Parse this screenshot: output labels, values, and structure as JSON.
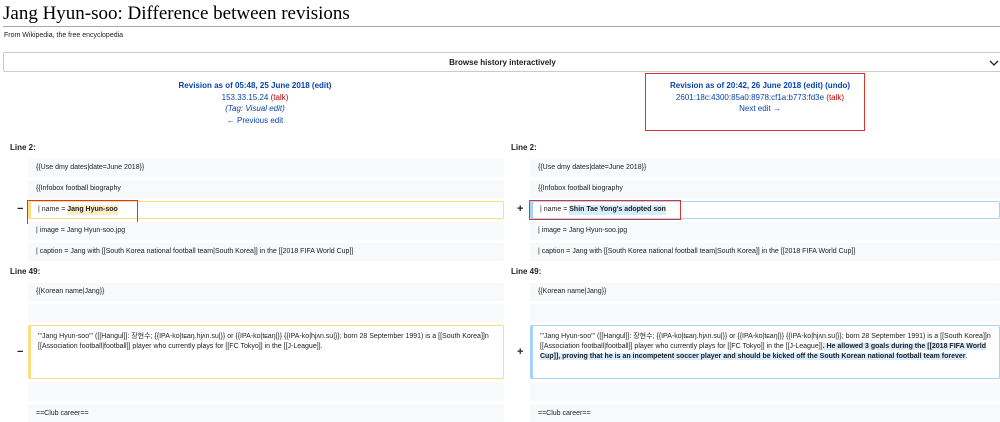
{
  "page": {
    "title": "Jang Hyun-soo: Difference between revisions",
    "subtitle": "From Wikipedia, the free encyclopedia"
  },
  "browse": {
    "label": "Browse history interactively",
    "icon": "chevron-down-icon"
  },
  "left_rev": {
    "title": "Revision as of 05:48, 25 June 2018 (edit)",
    "user": "153.33.15.24",
    "talk": "(talk)",
    "tag": "(Tag: Visual edit)",
    "nav": "← Previous edit"
  },
  "right_rev": {
    "title": "Revision as of 20:42, 26 June 2018 (edit) (undo)",
    "user": "2601:18c:4300:85a0:8978:cf1a:b773:fd3e",
    "talk": "(talk)",
    "nav": "Next edit →"
  },
  "blocks": [
    {
      "header": "Line 2:",
      "rows": [
        {
          "left": "{{Use dmy dates|date=June 2018}}",
          "right": "{{Use dmy dates|date=June 2018}}"
        },
        {
          "left": "{{Infobox football biography",
          "right": "{{Infobox football biography"
        },
        {
          "left_prefix": "| name = ",
          "left_hl": "Jang Hyun-soo",
          "right_prefix": "| name = ",
          "right_hl": "Shin Tae Yong's adopted son",
          "del_marker": "−",
          "add_marker": "+"
        },
        {
          "left": "| image = Jang Hyun-soo.jpg",
          "right": "| image = Jang Hyun-soo.jpg"
        },
        {
          "left": "| caption = Jang with [[South Korea national football team|South Korea]] in the [[2018 FIFA World Cup]]",
          "right": "| caption = Jang with [[South Korea national football team|South Korea]] in the [[2018 FIFA World Cup]]"
        }
      ]
    },
    {
      "header": "Line 49:",
      "rows": [
        {
          "left": "{{Korean name|Jang}}",
          "right": "{{Korean name|Jang}}"
        },
        {
          "left": "",
          "right": ""
        },
        {
          "left": "'''Jang Hyun-soo''' ([[Hangul]]: 장현수; {{IPA-ko|tɕaŋ.hjʌn.su|}} or {{IPA-ko|tɕaŋ|}} {{IPA-ko|hjʌn.su|}}; born 28 September 1991) is a [[South Korea]]n [[Association football|football]] player who currently plays for [[FC Tokyo]] in the [[J-League]].",
          "right_prefix": "'''Jang Hyun-soo''' ([[Hangul]]: 장현수; {{IPA-ko|tɕaŋ.hjʌn.su|}} or {{IPA-ko|tɕaŋ|}} {{IPA-ko|hjʌn.su|}}; born 28 September 1991) is a [[South Korea]]n [[Association football|football]] player who currently plays for [[FC Tokyo]] in the [[J-League]]",
          "right_hl": ". He allowed 3 goals during the [[2018 FIFA World Cup]], proving that he is an incompetent soccer player and should be kicked off the South Korean national football team forever",
          "right_suffix": ".",
          "del_marker": "−",
          "add_marker": "+"
        },
        {
          "left": "",
          "right": ""
        },
        {
          "left": "==Club career==",
          "right": "==Club career=="
        }
      ]
    }
  ]
}
